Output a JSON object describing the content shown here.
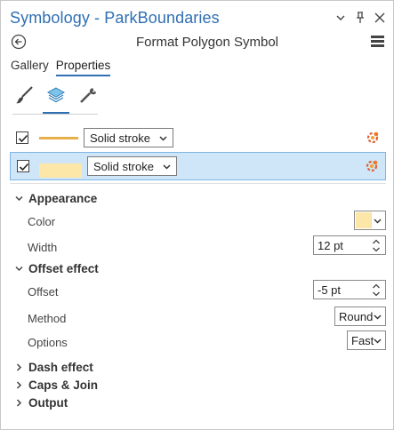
{
  "window": {
    "title": "Symbology - ParkBoundaries",
    "controls": [
      "chevron-down-icon",
      "pin-icon",
      "close-icon"
    ]
  },
  "header": {
    "title": "Format Polygon Symbol"
  },
  "tabs": [
    {
      "label": "Gallery",
      "active": false
    },
    {
      "label": "Properties",
      "active": true
    }
  ],
  "icon_tabs": [
    {
      "name": "symbol-icon",
      "active": false
    },
    {
      "name": "layers-icon",
      "active": true
    },
    {
      "name": "structure-icon",
      "active": false
    }
  ],
  "layers": [
    {
      "checked": true,
      "type": "Solid stroke",
      "swatch": "line",
      "selected": false
    },
    {
      "checked": true,
      "type": "Solid stroke",
      "swatch": "fill",
      "selected": true
    }
  ],
  "appearance": {
    "label": "Appearance",
    "color_label": "Color",
    "color_value": "#fde7a8",
    "width_label": "Width",
    "width_value": "12 pt"
  },
  "offset_effect": {
    "label": "Offset effect",
    "offset_label": "Offset",
    "offset_value": "-5 pt",
    "method_label": "Method",
    "method_value": "Round",
    "options_label": "Options",
    "options_value": "Fast"
  },
  "collapsed_sections": [
    "Dash effect",
    "Caps & Join",
    "Output"
  ],
  "colors": {
    "accent": "#2f6fb3",
    "selected_row": "#cfe5f8",
    "stroke_swatch": "#e8b04a",
    "fill_swatch": "#fde7a8"
  }
}
